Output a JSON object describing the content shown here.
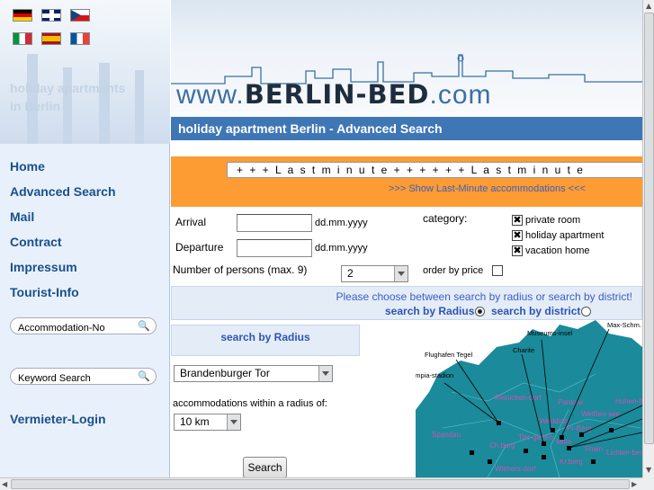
{
  "sidebar": {
    "flags": [
      "flag-de",
      "flag-uk",
      "flag-cz",
      "flag-it",
      "flag-es",
      "flag-fr"
    ],
    "tagline_line1": "holiday apartments",
    "tagline_line2": "in Berlin",
    "nav": [
      "Home",
      "Advanced Search",
      "Mail",
      "Contract",
      "Impressum",
      "Tourist-Info"
    ],
    "accommodation_no_placeholder": "Accommodation-No",
    "keyword_search_placeholder": "Keyword Search",
    "vermieter_login": "Vermieter-Login"
  },
  "header": {
    "brand_prefix": "www.",
    "brand_main": "BERLIN-BED",
    "brand_suffix": ".com",
    "title": "holiday apartment Berlin - Advanced Search"
  },
  "lastminute": {
    "ticker": "+ + +  L a s t m i n u t e  + + + + + +  L a s t m i n u t e",
    "link": ">>> Show Last-Minute accommodations <<<"
  },
  "form": {
    "arrival_label": "Arrival",
    "arrival_hint": "dd.mm.yyyy",
    "departure_label": "Departure",
    "departure_hint": "dd.mm.yyyy",
    "persons_label": "Number of persons (max. 9)",
    "persons_value": "2",
    "order_by_price_label": "order by price",
    "category_label": "category:",
    "categories": [
      {
        "label": "private room",
        "checked": true
      },
      {
        "label": "holiday apartment",
        "checked": true
      },
      {
        "label": "vacation home",
        "checked": true
      }
    ],
    "choose_text": "Please choose between search by radius or search by district!",
    "radius_option": "search by Radius",
    "district_option": "search by district",
    "radius_box_title": "search by Radius",
    "location_value": "Brandenburger Tor",
    "within_radius_label": "accommodations within a radius of:",
    "radius_value": "10 km",
    "search_button": "Search"
  },
  "map": {
    "labels": [
      "Max-Schm. Halle",
      "Museums-insel",
      "Charite",
      "Flughafen Tegel",
      "Olympia-stadion",
      "Reinicken-dorf",
      "Pankow",
      "Weißen-see",
      "Hohen-hausen",
      "Spandau",
      "Wedding",
      "Pr-Berg",
      "Tier-garten",
      "Mitte",
      "Ch.burg",
      "Fhain",
      "Lichten-berg",
      "Wilmers-dorf",
      "Kr.berg"
    ]
  },
  "colors": {
    "sidebar_bg": "#e8f1fb",
    "nav_link": "#1a4f8c",
    "title_bar": "#3f76b6",
    "lastminute_bg": "#fc9c32",
    "link_blue": "#3a5ec6",
    "map_teal": "#1b8a9a"
  }
}
